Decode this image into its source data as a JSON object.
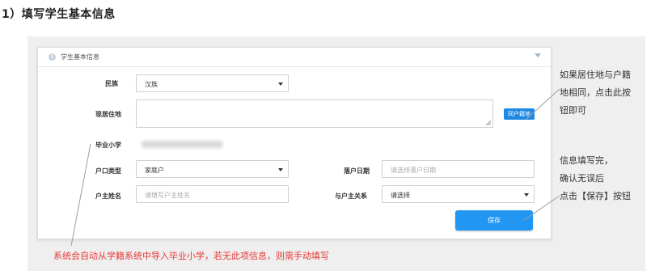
{
  "heading": "1）填写学生基本信息",
  "panel": {
    "title": "学生基本信息",
    "info_icon": "info-icon",
    "collapse_icon": "chevron-down-icon"
  },
  "form": {
    "ethnicity": {
      "label": "民族",
      "value": "汉族"
    },
    "residence": {
      "label": "现居住地",
      "value": ""
    },
    "same_as_household_button": "同户籍地",
    "primary_school": {
      "label": "毕业小学"
    },
    "household_type": {
      "label": "户口类型",
      "value": "家庭户"
    },
    "household_date": {
      "label": "落户日期",
      "placeholder": "请选择落户日期"
    },
    "householder_name": {
      "label": "户主姓名",
      "placeholder": "请填写户主姓名"
    },
    "relationship": {
      "label": "与户主关系",
      "value": "请选择"
    },
    "save_button": "保存"
  },
  "annotations": {
    "same_address": [
      "如果居住地与户籍",
      "地相同，点击此按",
      "钮即可"
    ],
    "save_hint": [
      "信息填写完，",
      "确认无误后",
      "点击【保存】按钮"
    ],
    "import_hint": "系统会自动从学籍系统中导入毕业小学，若无此项信息，则需手动填写"
  },
  "colors": {
    "accent": "#2196f3",
    "annotation_red": "#e53935",
    "frame_gray": "#efefef"
  }
}
